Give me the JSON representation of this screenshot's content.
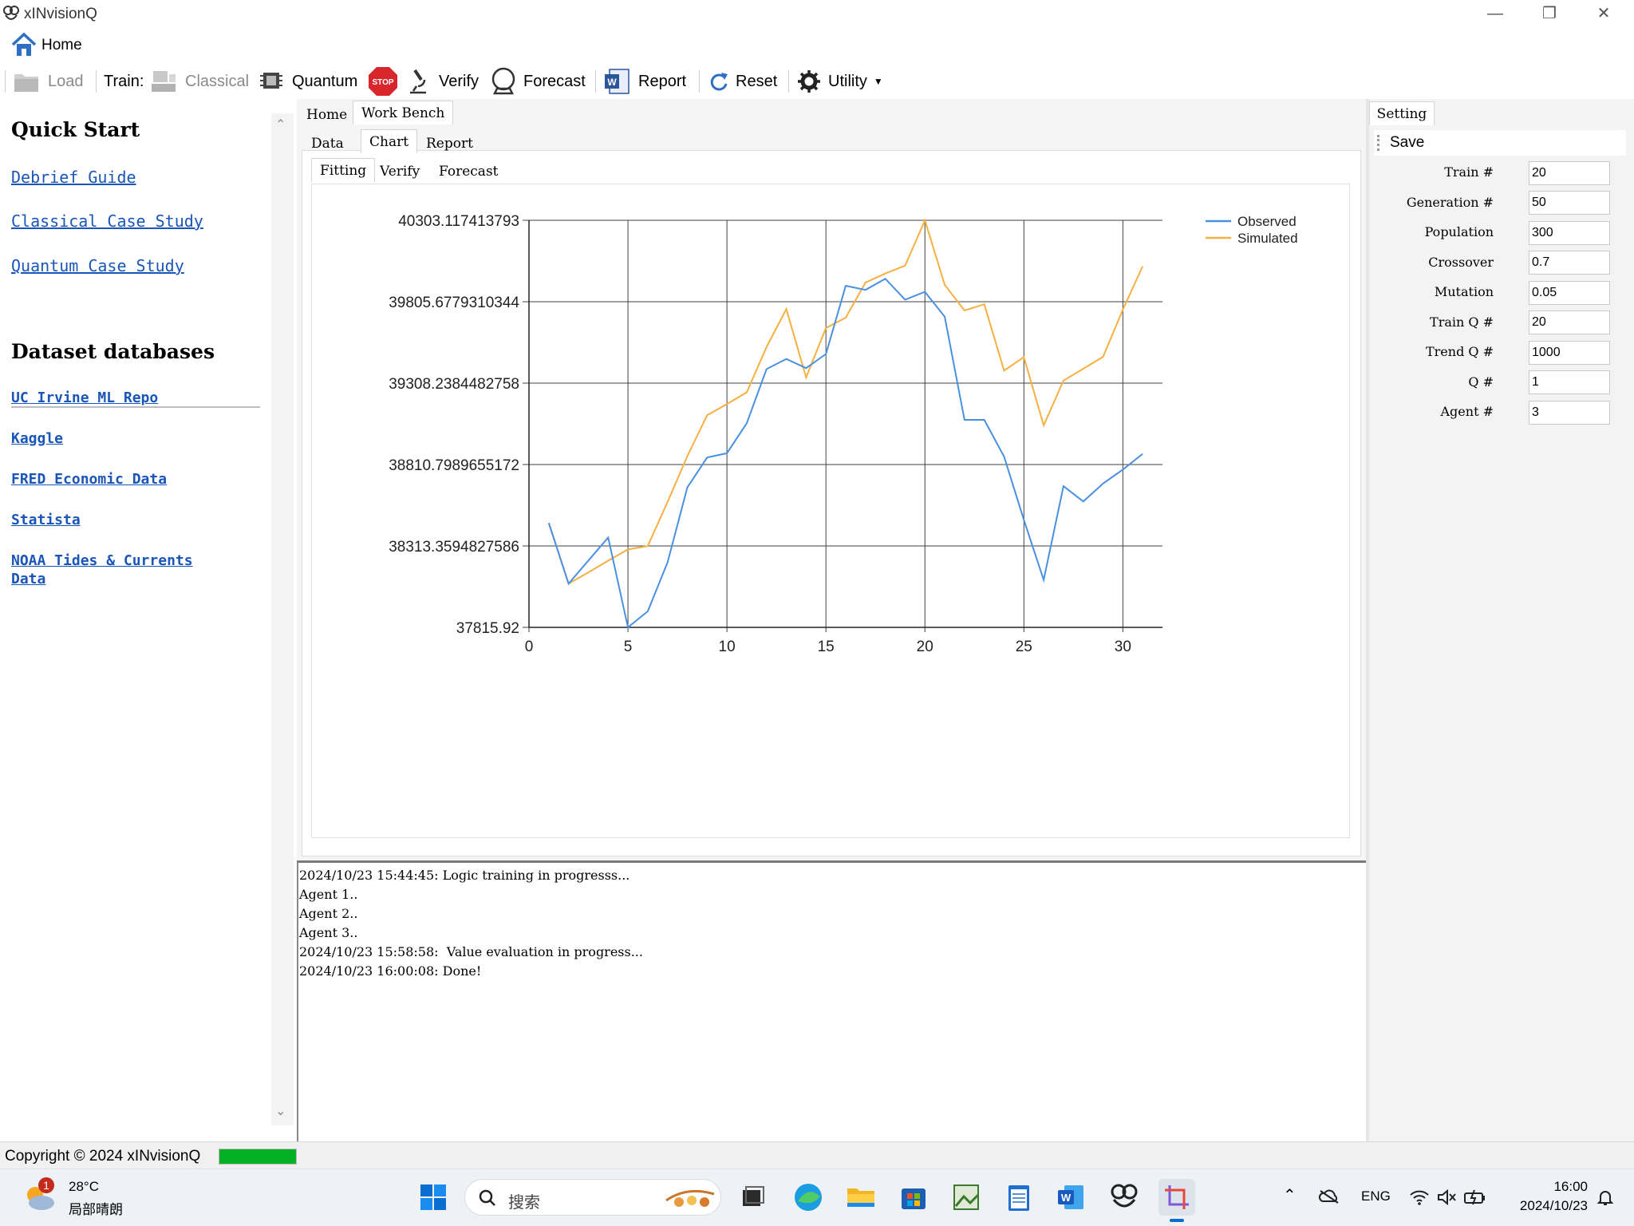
{
  "window": {
    "title": "xINvisionQ"
  },
  "menu": {
    "home": "Home"
  },
  "toolbar": {
    "load": "Load",
    "train": "Train:",
    "classical": "Classical",
    "quantum": "Quantum",
    "stop": "STOP",
    "verify": "Verify",
    "forecast": "Forecast",
    "report": "Report",
    "reset": "Reset",
    "utility": "Utility"
  },
  "left_panel": {
    "quick_start": "Quick Start",
    "links": [
      "Debrief Guide",
      "Classical Case Study",
      "Quantum Case Study"
    ],
    "datasets_heading": "Dataset databases",
    "datasets": [
      "UC Irvine ML Repo",
      "Kaggle",
      "FRED Economic Data",
      "Statista",
      "NOAA Tides & Currents Data"
    ]
  },
  "tabs": {
    "main": [
      "Home",
      "Work Bench"
    ],
    "sub": [
      "Data",
      "Chart",
      "Report"
    ],
    "chart": [
      "Fitting",
      "Verify",
      "Forecast"
    ]
  },
  "chart_data": {
    "type": "line",
    "title": "",
    "xlabel": "",
    "ylabel": "",
    "xlim": [
      0,
      32
    ],
    "ylim": [
      37815.92,
      40303.117413793
    ],
    "x_ticks": [
      0,
      5,
      10,
      15,
      20,
      25,
      30
    ],
    "y_ticks": [
      "37815.92",
      "38313.3594827586",
      "38810.7989655172",
      "39308.2384482758",
      "39805.6779310344",
      "40303.117413793"
    ],
    "legend_position": "top-right",
    "grid": true,
    "x": [
      1,
      2,
      3,
      4,
      5,
      6,
      7,
      8,
      9,
      10,
      11,
      12,
      13,
      14,
      15,
      16,
      17,
      18,
      19,
      20,
      21,
      22,
      23,
      24,
      25,
      26,
      27,
      28,
      29,
      30,
      31
    ],
    "series": [
      {
        "name": "Observed",
        "color": "#4a90e2",
        "values": [
          38454,
          38083,
          38224,
          38365,
          37816,
          37914,
          38213,
          38671,
          38854,
          38880,
          39063,
          39394,
          39456,
          39400,
          39486,
          39903,
          39878,
          39946,
          39818,
          39866,
          39714,
          39084,
          39084,
          38859,
          38472,
          38106,
          38679,
          38585,
          38695,
          38780,
          38876
        ]
      },
      {
        "name": "Simulated",
        "color": "#f5b041",
        "values": [
          38454,
          38083,
          38152,
          38223,
          38292,
          38313,
          38582,
          38862,
          39112,
          39180,
          39252,
          39529,
          39761,
          39343,
          39645,
          39708,
          39923,
          39978,
          40026,
          40303,
          39909,
          39752,
          39790,
          39385,
          39467,
          39050,
          39324,
          39396,
          39469,
          39758,
          40022
        ]
      }
    ]
  },
  "log": {
    "lines": [
      "2024/10/23 15:44:45: Logic training in progresss...",
      "Agent 1..",
      "Agent 2..",
      "Agent 3..",
      "2024/10/23 15:58:58:  Value evaluation in progress...",
      "2024/10/23 16:00:08: Done!"
    ]
  },
  "settings": {
    "tab": "Setting",
    "save": "Save",
    "fields": [
      {
        "label": "Train #",
        "value": "20"
      },
      {
        "label": "Generation #",
        "value": "50"
      },
      {
        "label": "Population",
        "value": "300"
      },
      {
        "label": "Crossover",
        "value": "0.7"
      },
      {
        "label": "Mutation",
        "value": "0.05"
      },
      {
        "label": "Train Q #",
        "value": "20"
      },
      {
        "label": "Trend Q #",
        "value": "1000"
      },
      {
        "label": "Q #",
        "value": "1"
      },
      {
        "label": "Agent #",
        "value": "3"
      }
    ]
  },
  "statusbar": {
    "copyright": "Copyright © 2024 xINvisionQ",
    "progress": 1.0
  },
  "taskbar": {
    "weather_temp": "28°C",
    "weather_desc": "局部晴朗",
    "weather_badge": "1",
    "search_placeholder": "搜索",
    "lang": "ENG",
    "time": "16:00",
    "date": "2024/10/23"
  },
  "colors": {
    "accent": "#1a55b8",
    "observed": "#4a90e2",
    "simulated": "#f5b041",
    "progress": "#06b025"
  }
}
